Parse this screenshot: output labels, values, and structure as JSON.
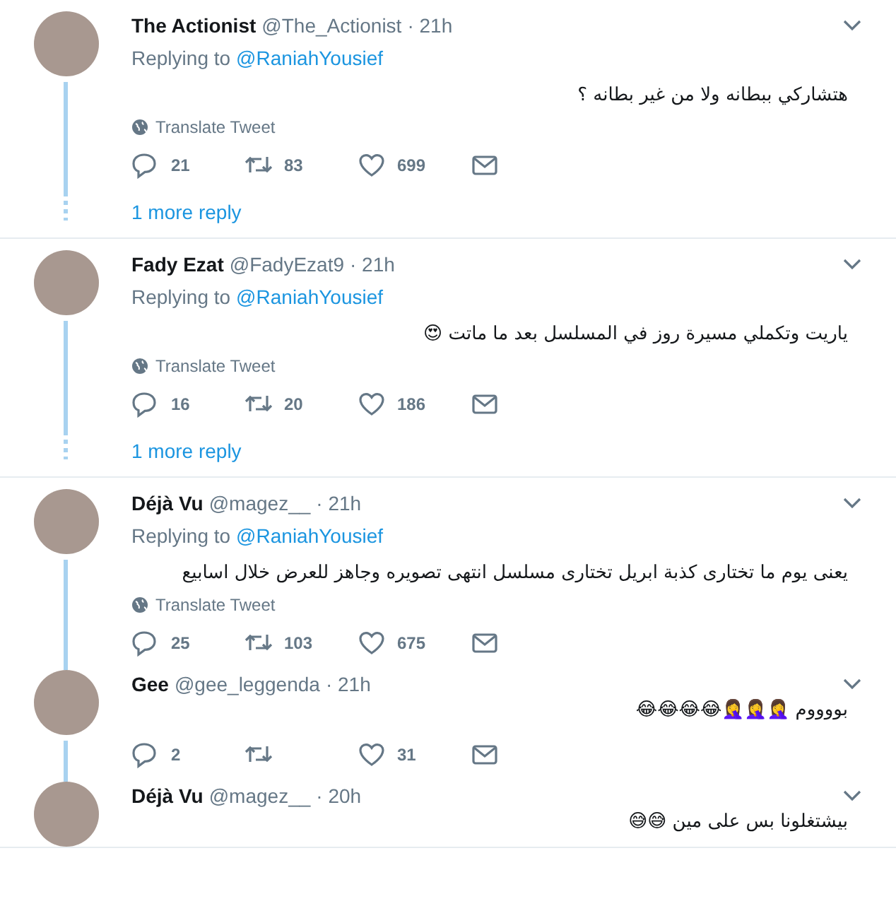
{
  "conversations": [
    {
      "tweets": [
        {
          "name": "The Actionist",
          "handle": "@The_Actionist",
          "time": "· 21h",
          "replying_label": "Replying to",
          "replying_to": "@RaniahYousief",
          "text": "هتشاركي ببطانه ولا من غير بطانه ؟",
          "translate": "Translate Tweet",
          "replies": "21",
          "retweets": "83",
          "likes": "699"
        }
      ],
      "more_reply": "1 more reply"
    },
    {
      "tweets": [
        {
          "name": "Fady Ezat",
          "handle": "@FadyEzat9",
          "time": "· 21h",
          "replying_label": "Replying to",
          "replying_to": "@RaniahYousief",
          "text": "ياريت وتكملي مسيرة روز في المسلسل بعد ما ماتت 😍",
          "translate": "Translate Tweet",
          "replies": "16",
          "retweets": "20",
          "likes": "186"
        }
      ],
      "more_reply": "1 more reply"
    },
    {
      "tweets": [
        {
          "name": "Déjà Vu",
          "handle": "@magez__",
          "time": "· 21h",
          "replying_label": "Replying to",
          "replying_to": "@RaniahYousief",
          "text": "يعنى يوم ما تختارى كذبة ابريل تختارى مسلسل انتهى تصويره وجاهز للعرض خلال اسابيع",
          "translate": "Translate Tweet",
          "replies": "25",
          "retweets": "103",
          "likes": "675"
        },
        {
          "name": "Gee",
          "handle": "@gee_leggenda",
          "time": "· 21h",
          "text": "بووووم 🤦‍♀️🤦‍♀️🤦‍♀️😂😂😂😂",
          "replies": "2",
          "likes": "31"
        },
        {
          "name": "Déjà Vu",
          "handle": "@magez__",
          "time": "· 20h",
          "text": "بيشتغلونا بس على مين 😅😅"
        }
      ]
    }
  ]
}
